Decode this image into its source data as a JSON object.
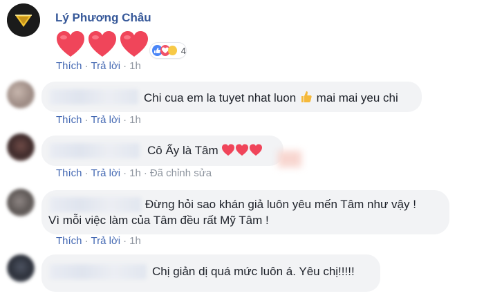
{
  "post": {
    "author": "Lý Phương Châu",
    "reaction_count": "4",
    "reaction_icons": [
      "like-icon",
      "love-icon",
      "haha-icon"
    ],
    "actions": {
      "like": "Thích",
      "reply": "Trả lời",
      "time": "1h"
    }
  },
  "comments": [
    {
      "text": "Chi cua em la tuyet nhat luon",
      "text2": "mai mai yeu chi",
      "actions": {
        "like": "Thích",
        "reply": "Trả lời",
        "time": "1h"
      }
    },
    {
      "text": "Cô Ấy là Tâm",
      "actions": {
        "like": "Thích",
        "reply": "Trả lời",
        "time": "1h",
        "edited": "Đã chỉnh sửa"
      }
    },
    {
      "line1": "Đừng hỏi sao khán giả luôn yêu mến Tâm như vậy !",
      "line2": "Vì mỗi việc làm của Tâm đều rất Mỹ Tâm !",
      "actions": {
        "like": "Thích",
        "reply": "Trả lời",
        "time": "1h"
      }
    },
    {
      "text": "Chị giản dị quá mức luôn á. Yêu chị!!!!!"
    }
  ],
  "colors": {
    "link": "#4267b2",
    "author": "#365899",
    "meta": "#8d949e",
    "bubble": "#f2f3f5",
    "heart": "#f0455a"
  }
}
